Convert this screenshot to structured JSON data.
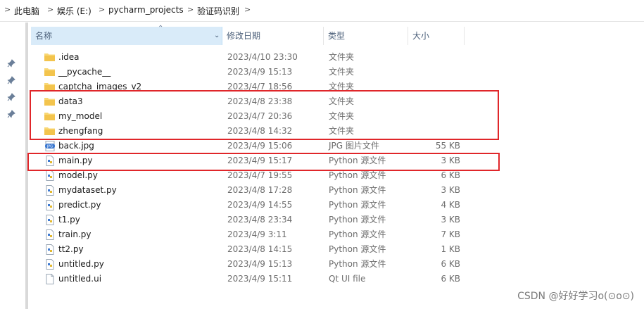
{
  "breadcrumb": {
    "items": [
      "此电脑",
      "娱乐 (E:)",
      "pycharm_projects",
      "验证码识别"
    ]
  },
  "columns": {
    "name": "名称",
    "date": "修改日期",
    "type": "类型",
    "size": "大小"
  },
  "files": [
    {
      "name": ".idea",
      "date": "2023/4/10 23:30",
      "type": "文件夹",
      "size": "",
      "icon": "folder-icon"
    },
    {
      "name": "__pycache__",
      "date": "2023/4/9 15:13",
      "type": "文件夹",
      "size": "",
      "icon": "folder-icon"
    },
    {
      "name": "captcha_images_v2",
      "date": "2023/4/7 18:56",
      "type": "文件夹",
      "size": "",
      "icon": "folder-icon"
    },
    {
      "name": "data3",
      "date": "2023/4/8 23:38",
      "type": "文件夹",
      "size": "",
      "icon": "folder-icon"
    },
    {
      "name": "my_model",
      "date": "2023/4/7 20:36",
      "type": "文件夹",
      "size": "",
      "icon": "folder-icon"
    },
    {
      "name": "zhengfang",
      "date": "2023/4/8 14:32",
      "type": "文件夹",
      "size": "",
      "icon": "folder-icon"
    },
    {
      "name": "back.jpg",
      "date": "2023/4/9 15:06",
      "type": "JPG 图片文件",
      "size": "55 KB",
      "icon": "jpg-file-icon"
    },
    {
      "name": "main.py",
      "date": "2023/4/9 15:17",
      "type": "Python 源文件",
      "size": "3 KB",
      "icon": "python-file-icon"
    },
    {
      "name": "model.py",
      "date": "2023/4/7 19:55",
      "type": "Python 源文件",
      "size": "6 KB",
      "icon": "python-file-icon"
    },
    {
      "name": "mydataset.py",
      "date": "2023/4/8 17:28",
      "type": "Python 源文件",
      "size": "3 KB",
      "icon": "python-file-icon"
    },
    {
      "name": "predict.py",
      "date": "2023/4/9 14:55",
      "type": "Python 源文件",
      "size": "4 KB",
      "icon": "python-file-icon"
    },
    {
      "name": "t1.py",
      "date": "2023/4/8 23:34",
      "type": "Python 源文件",
      "size": "3 KB",
      "icon": "python-file-icon"
    },
    {
      "name": "train.py",
      "date": "2023/4/9 3:11",
      "type": "Python 源文件",
      "size": "7 KB",
      "icon": "python-file-icon"
    },
    {
      "name": "tt2.py",
      "date": "2023/4/8 14:15",
      "type": "Python 源文件",
      "size": "1 KB",
      "icon": "python-file-icon"
    },
    {
      "name": "untitled.py",
      "date": "2023/4/9 15:13",
      "type": "Python 源文件",
      "size": "6 KB",
      "icon": "python-file-icon"
    },
    {
      "name": "untitled.ui",
      "date": "2023/4/9 15:11",
      "type": "Qt UI file",
      "size": "6 KB",
      "icon": "ui-file-icon"
    }
  ],
  "watermark": "CSDN @好好学习o(⊙o⊙)",
  "colors": {
    "highlight": "#e0262a",
    "folder": "#f8d775",
    "header_active": "#d9ebf9"
  }
}
